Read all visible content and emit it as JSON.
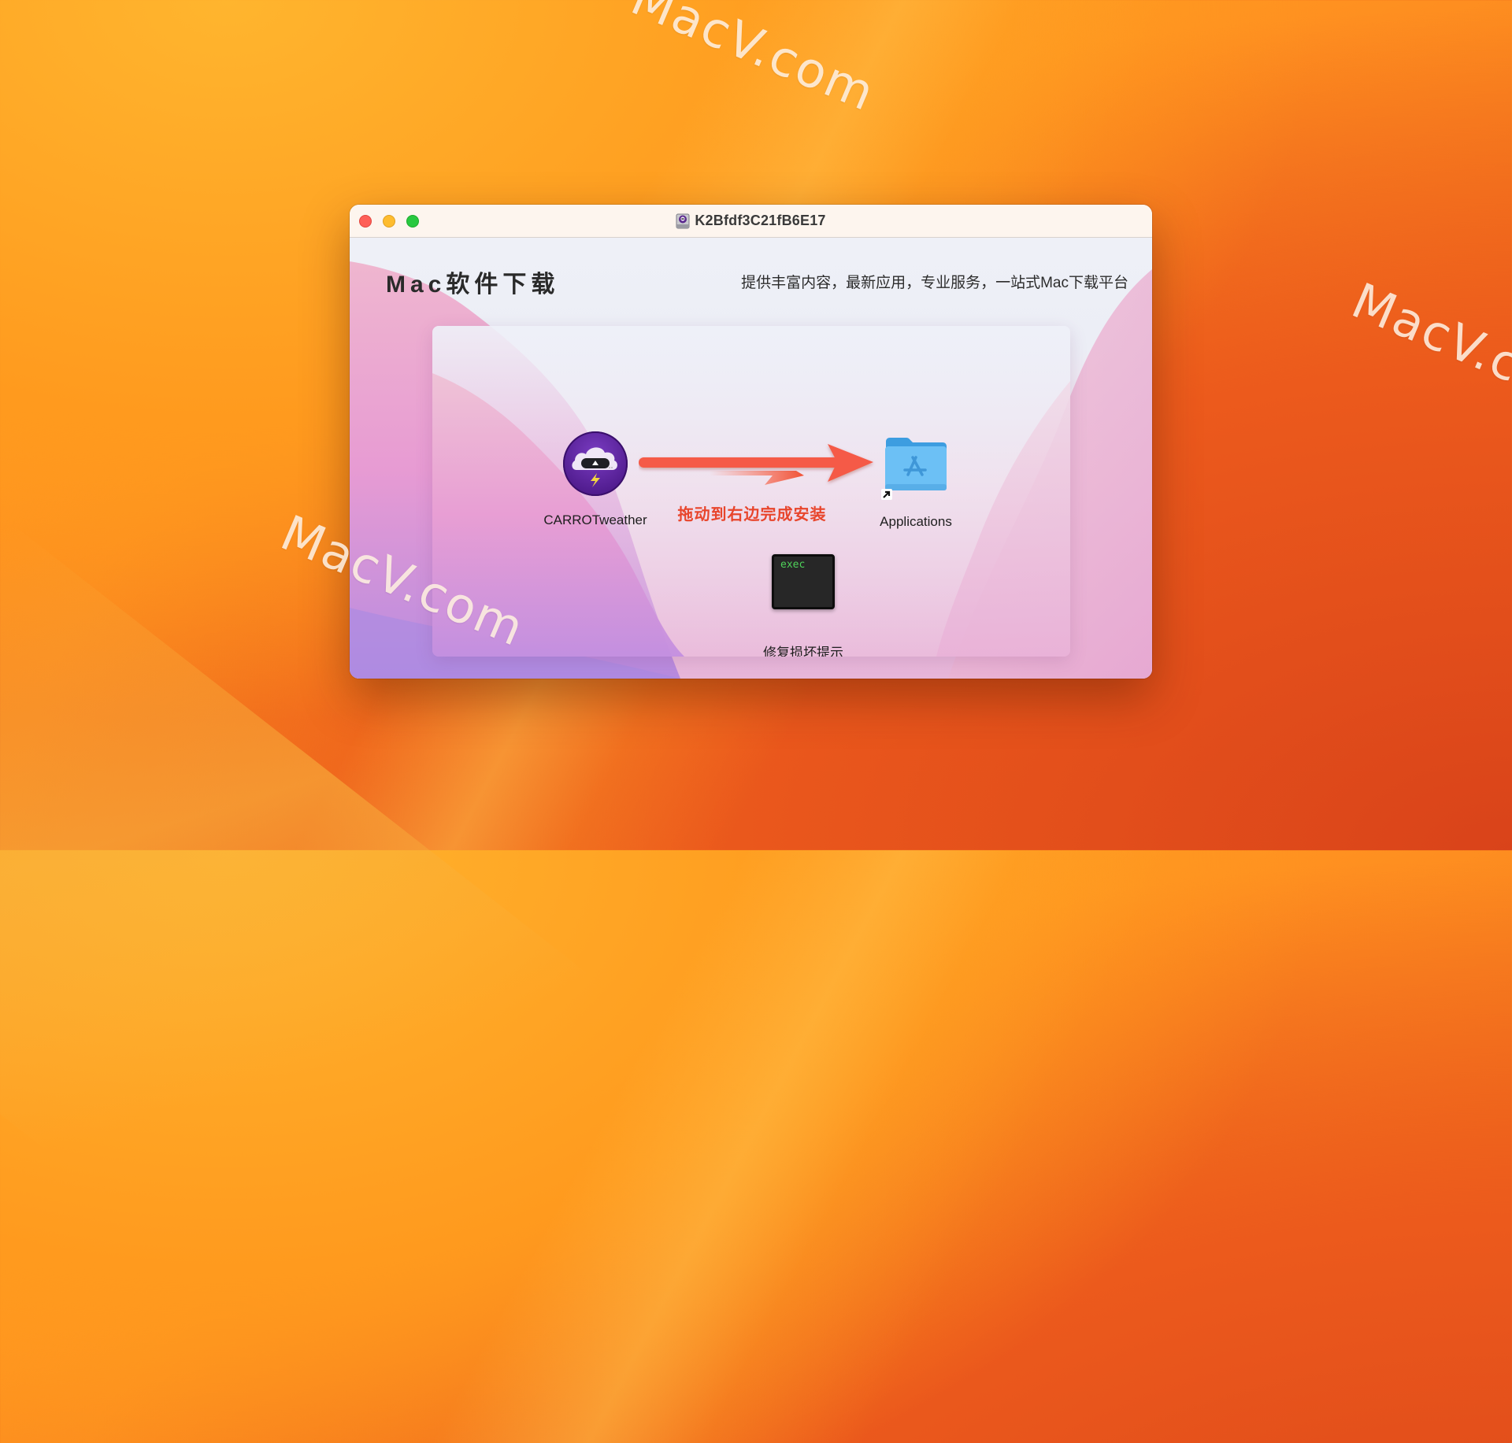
{
  "desktop": {
    "watermarks": [
      "MacV.com",
      "MacV.com",
      "MacV.com"
    ]
  },
  "window": {
    "title": "K2Bfdf3C21fB6E17",
    "title_icon": "disk-image-icon",
    "buttons": {
      "close": "close",
      "minimize": "minimize",
      "zoom": "zoom"
    }
  },
  "header": {
    "brand": "Mac软件下载",
    "slogan": "提供丰富内容，最新应用，专业服务，一站式Mac下载平台"
  },
  "installer": {
    "app": {
      "label": "CARROTweather",
      "icon": "carrot-weather-icon"
    },
    "hint": "拖动到右边完成安装",
    "hint_color": "#e8452c",
    "target": {
      "label": "Applications",
      "icon": "applications-folder-icon"
    },
    "repair": {
      "label": "修复损坏提示",
      "icon_text": "exec",
      "icon": "terminal-exec-icon"
    }
  }
}
